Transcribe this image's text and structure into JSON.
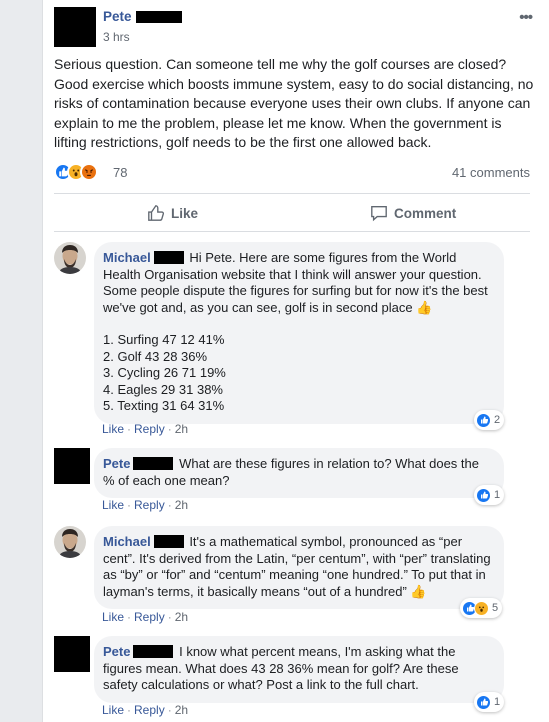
{
  "post": {
    "author": "Pete",
    "time": "3 hrs",
    "more": "•••",
    "text": "Serious question. Can someone tell me why the golf courses are closed? Good exercise which boosts immune system, easy to do social distancing, no risks of contamination because everyone uses their own clubs. If anyone can explain to me the problem, please let me know. When the government is lifting restrictions, golf needs to be the first one allowed back.",
    "reaction_count": "78",
    "comments_count": "41 comments",
    "like_label": "Like",
    "comment_label": "Comment"
  },
  "comments": [
    {
      "author": "Michael",
      "text": "Hi Pete. Here are some figures from the World Health Organisation website that I think will answer your question. Some people dispute the figures for surfing but for now it's the best we've got and, as you can see, golf is in second place",
      "emoji": "👍",
      "list": [
        "1. Surfing 47 12 41%",
        "2. Golf 43 28 36%",
        "3. Cycling 26 71 19%",
        "4. Eagles 29 31 38%",
        "5. Texting 31 64 31%"
      ],
      "like": "Like",
      "reply": "Reply",
      "time": "2h",
      "reaction_count": "2"
    },
    {
      "author": "Pete",
      "text": "What are these figures in relation to? What does the % of each one mean?",
      "like": "Like",
      "reply": "Reply",
      "time": "2h",
      "reaction_count": "1"
    },
    {
      "author": "Michael",
      "text": "It's a mathematical symbol, pronounced as “per cent”. It's derived from the Latin, “per centum”, with “per” translating as “by” or “for” and “centum” meaning “one hundred.” To put that in layman's terms, it basically means “out of a hundred”",
      "emoji": "👍",
      "like": "Like",
      "reply": "Reply",
      "time": "2h",
      "reaction_count": "5"
    },
    {
      "author": "Pete",
      "text": "I know what percent means, I'm asking what the figures mean. What does 43 28 36% mean for golf? Are these safety calculations or what? Post a link to the full chart.",
      "like": "Like",
      "reply": "Reply",
      "time": "2h",
      "reaction_count": "1"
    }
  ],
  "colors": {
    "link": "#385898",
    "like_blue": "#1877f2",
    "bubble": "#f2f3f5",
    "muted": "#606770"
  },
  "icons": [
    "more-options-icon",
    "like-reaction-icon",
    "wow-reaction-icon",
    "angry-reaction-icon",
    "thumbs-up-icon",
    "comment-icon"
  ]
}
